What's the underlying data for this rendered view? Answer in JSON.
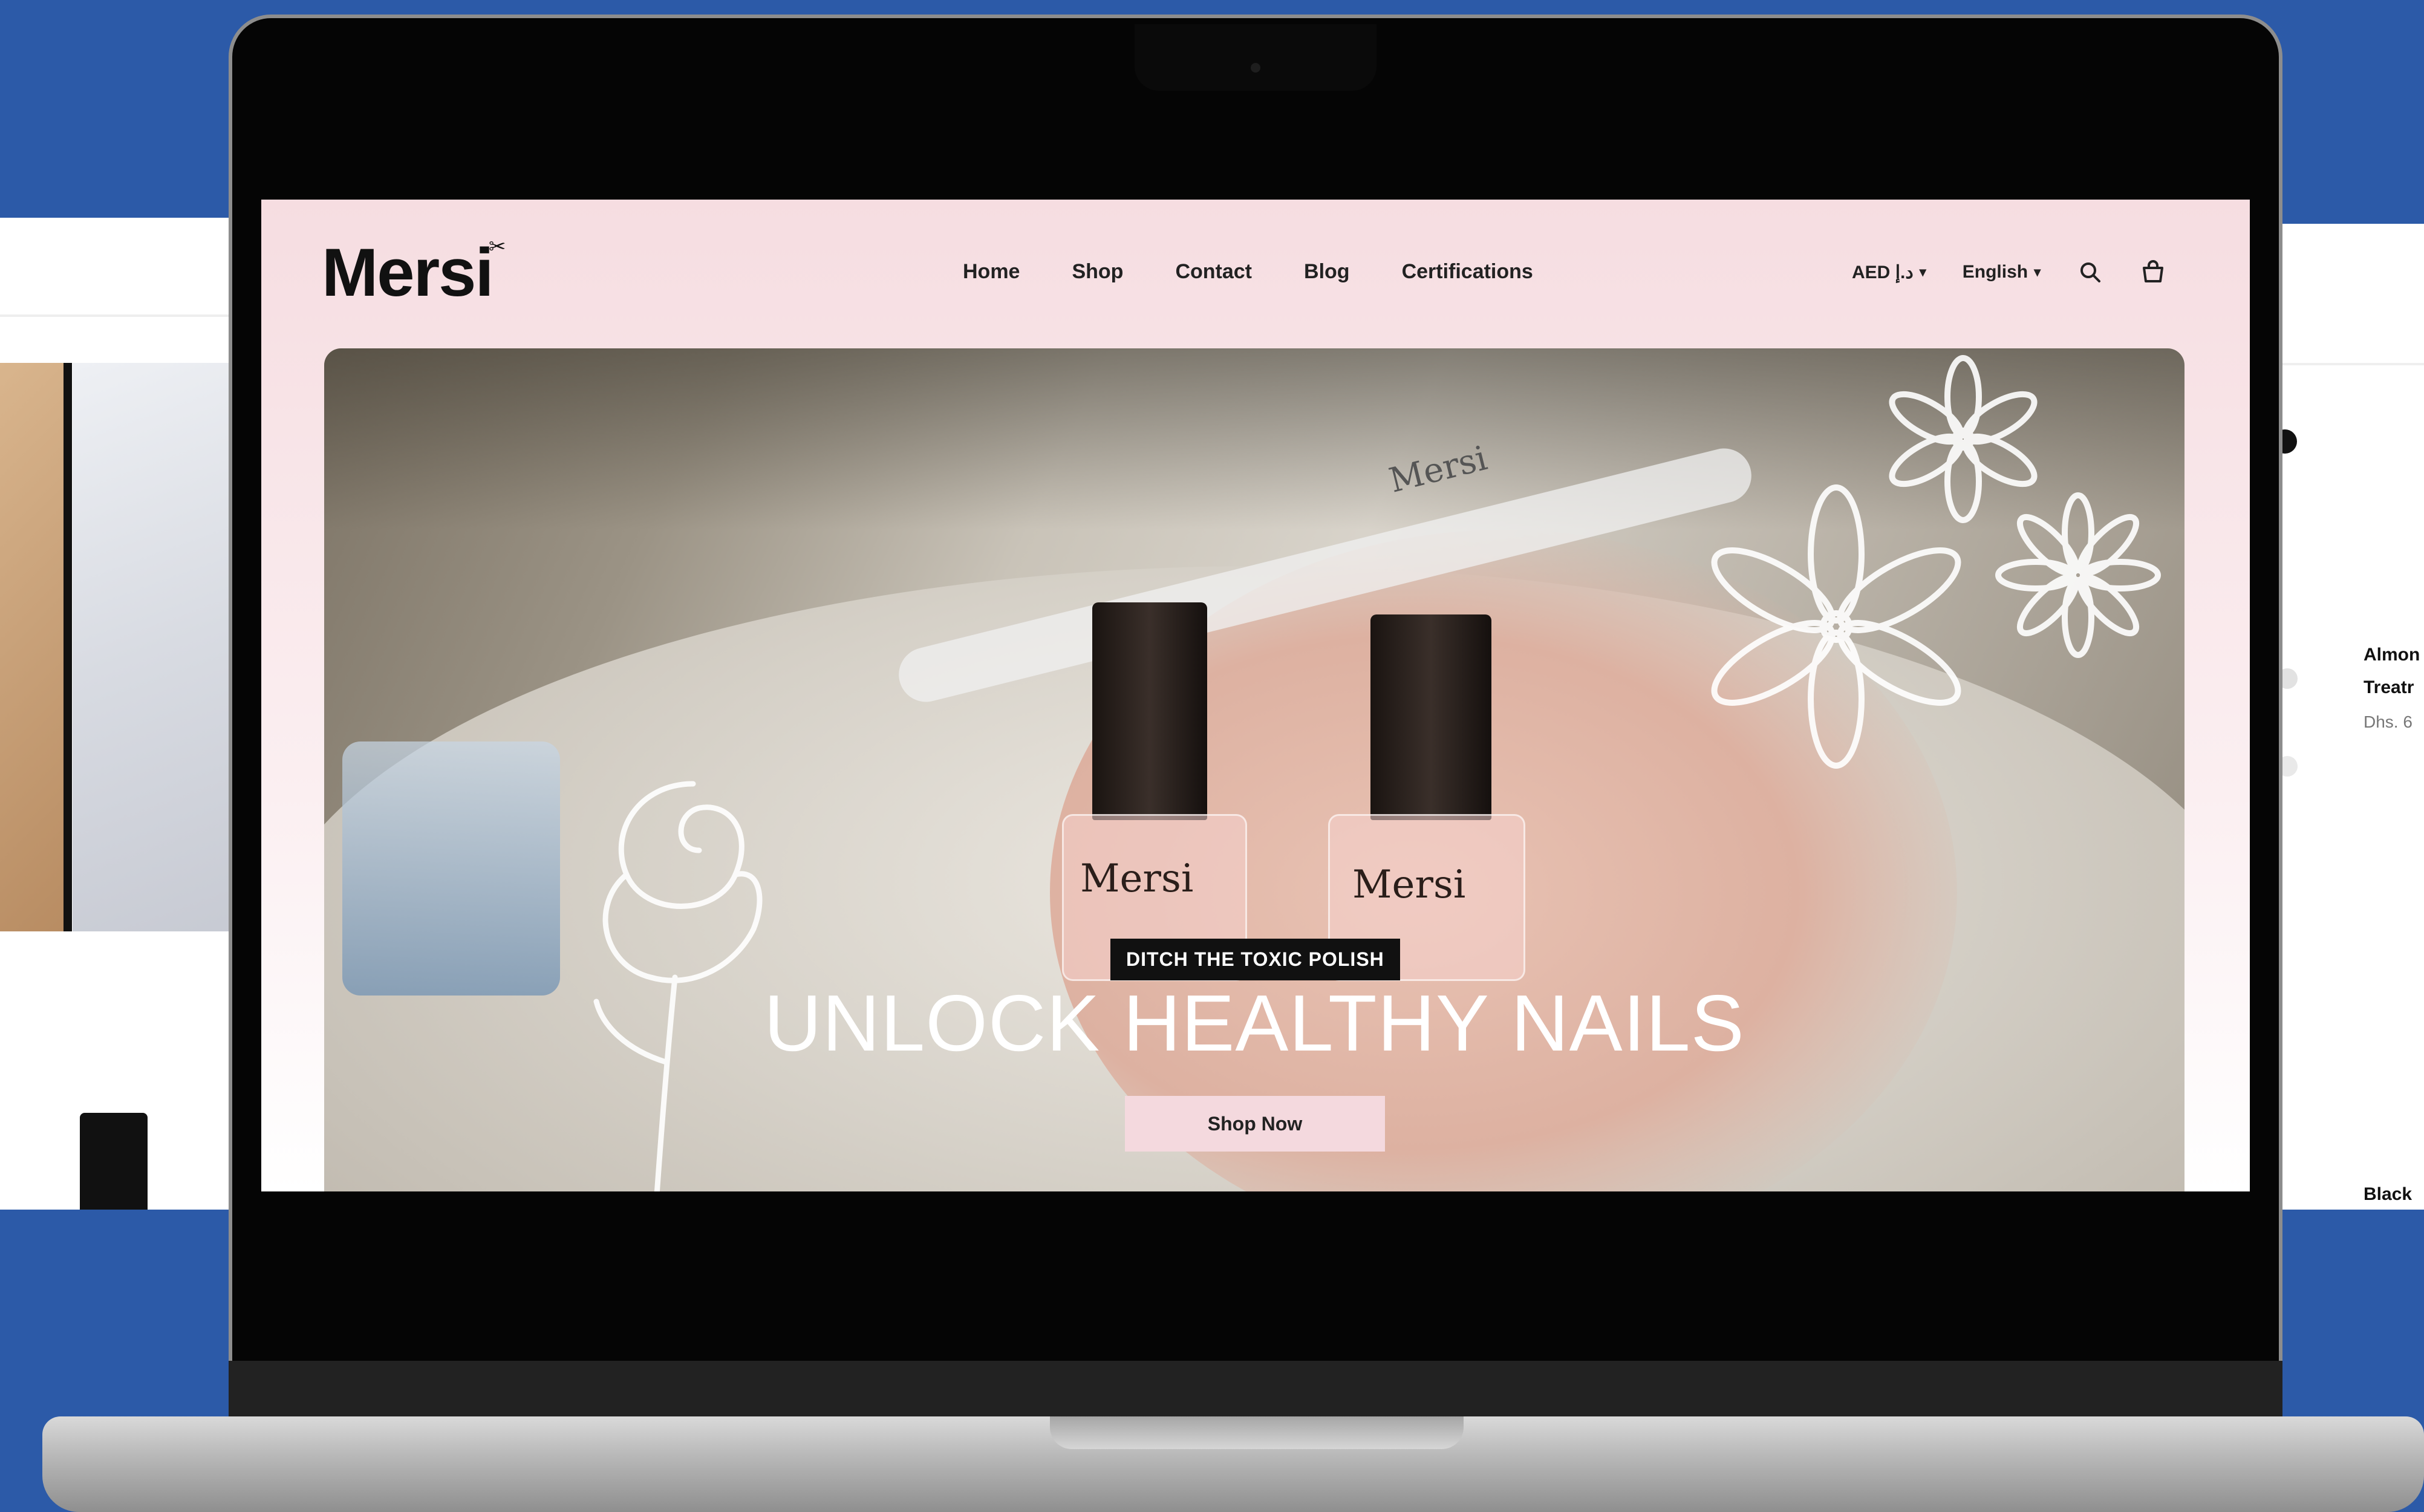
{
  "brand": {
    "name": "Mersi",
    "mark": "✂"
  },
  "nav": {
    "items": [
      "Home",
      "Shop",
      "Contact",
      "Blog",
      "Certifications"
    ]
  },
  "tools": {
    "currency": "AED د.إ",
    "language": "English"
  },
  "hero": {
    "badge": "DITCH THE TOXIC POLISH",
    "title": "UNLOCK HEALTHY NAILS",
    "cta": "Shop Now",
    "bottle_label": "Mersi",
    "nail_file_label": "Mersi"
  },
  "right_panel": {
    "product_name_line1": "Almon",
    "product_name_line2": "Treatr",
    "price": "Dhs. 6",
    "next_product": "Black"
  },
  "colors": {
    "backdrop": "#2c5aa8",
    "screen_pink": "#f6dde1",
    "cta_pink": "#f4d9de"
  }
}
